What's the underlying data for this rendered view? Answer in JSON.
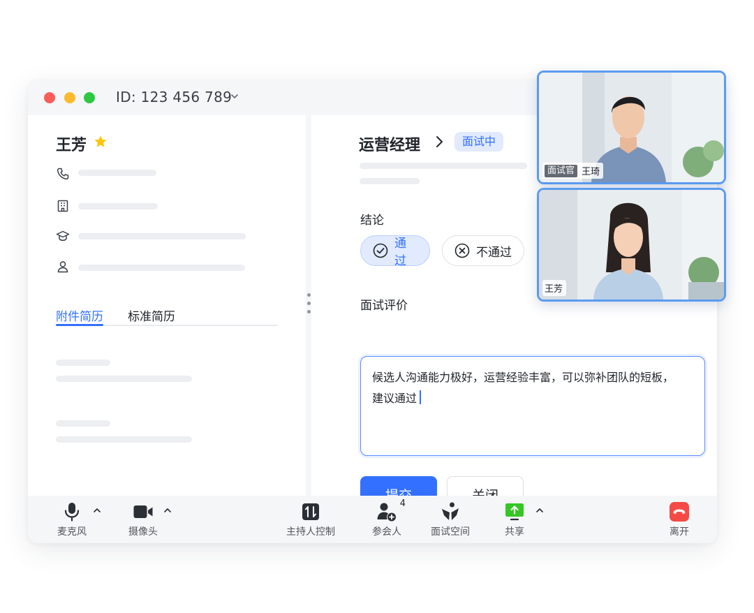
{
  "window": {
    "meeting_id": "ID: 123 456 789"
  },
  "candidate": {
    "name": "王芳",
    "tabs": [
      {
        "label": "附件简历",
        "active": true
      },
      {
        "label": "标准简历",
        "active": false
      }
    ]
  },
  "interview": {
    "job_title": "运营经理",
    "status": "面试中",
    "conclusion_label": "结论",
    "pass_label": "通过",
    "fail_label": "不通过",
    "pass_selected": true,
    "evaluation_label": "面试评价",
    "evaluation_line1": "候选人沟通能力极好，运营经验丰富，可以弥补团队的短板，",
    "evaluation_line2": "建议通过",
    "submit_label": "提交",
    "close_label": "关闭"
  },
  "toolbar": {
    "mic": "麦克风",
    "camera": "摄像头",
    "host_control": "主持人控制",
    "participants": "参会人",
    "participants_count": "4",
    "interview_space": "面试空间",
    "share": "共享",
    "leave": "离开"
  },
  "video_tiles": {
    "interviewer_role": "面试官",
    "interviewer_name": "王琦",
    "candidate_name": "王芳"
  },
  "colors": {
    "accent": "#3370ff",
    "share": "#34c724",
    "leave": "#f54a45",
    "star": "#ffc60a"
  }
}
